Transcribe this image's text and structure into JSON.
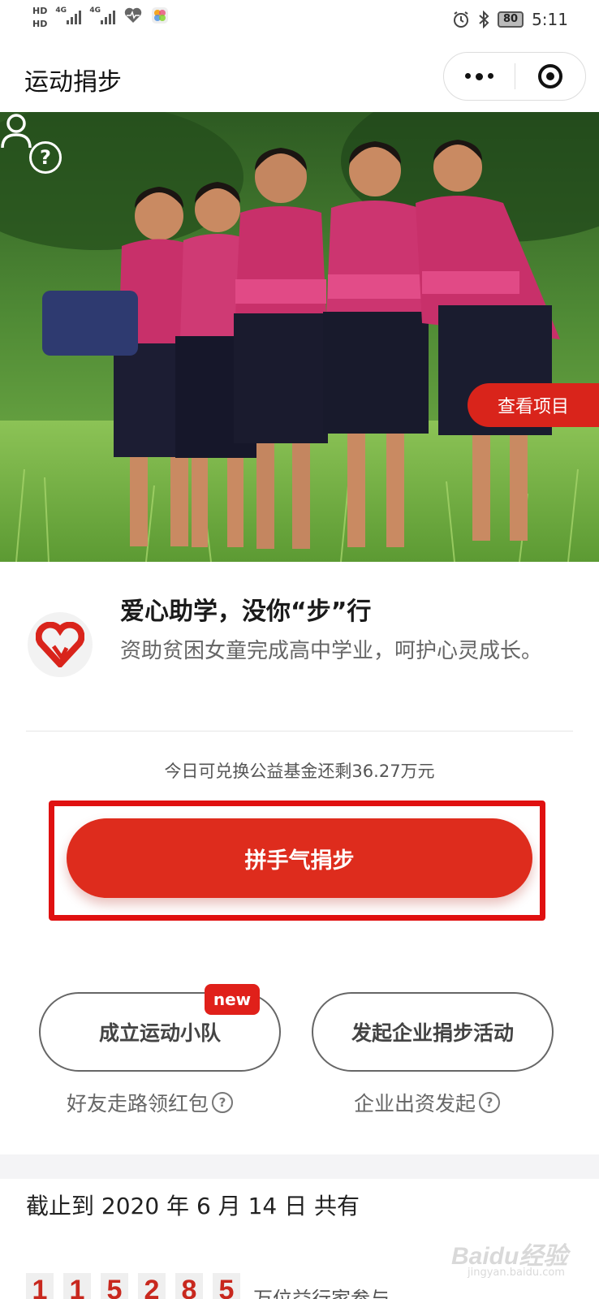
{
  "status_bar": {
    "hd1": "HD",
    "hd2": "HD",
    "net1": "4G",
    "net2": "4G",
    "battery": "80",
    "time": "5:11"
  },
  "nav": {
    "title": "运动捐步",
    "icons": [
      "more-icon",
      "close-miniprogram-icon"
    ]
  },
  "hero": {
    "view_project": "查看项目",
    "icons": [
      "help-icon",
      "user-icon"
    ]
  },
  "project": {
    "title": "爱心助学，没你“步”行",
    "description": "资助贫困女童完成高中学业，呵护心灵成长。"
  },
  "donate": {
    "remaining_text": "今日可兑换公益基金还剩36.27万元",
    "button_label": "拼手气捐步"
  },
  "actions": {
    "team_button": "成立运动小队",
    "team_badge": "new",
    "team_note": "好友走路领红包",
    "company_button": "发起企业捐步活动",
    "company_note": "企业出资发起"
  },
  "stats": {
    "date_text": "截止到 2020 年 6 月 14 日 共有",
    "digits": [
      "1",
      "1",
      "5",
      "2",
      "8",
      "5"
    ],
    "suffix": "万位益行家参与"
  },
  "watermark": {
    "main": "Baidu经验",
    "sub": "jingyan.baidu.com"
  },
  "colors": {
    "accent": "#de2c1d",
    "highlight_box": "#e01010"
  }
}
